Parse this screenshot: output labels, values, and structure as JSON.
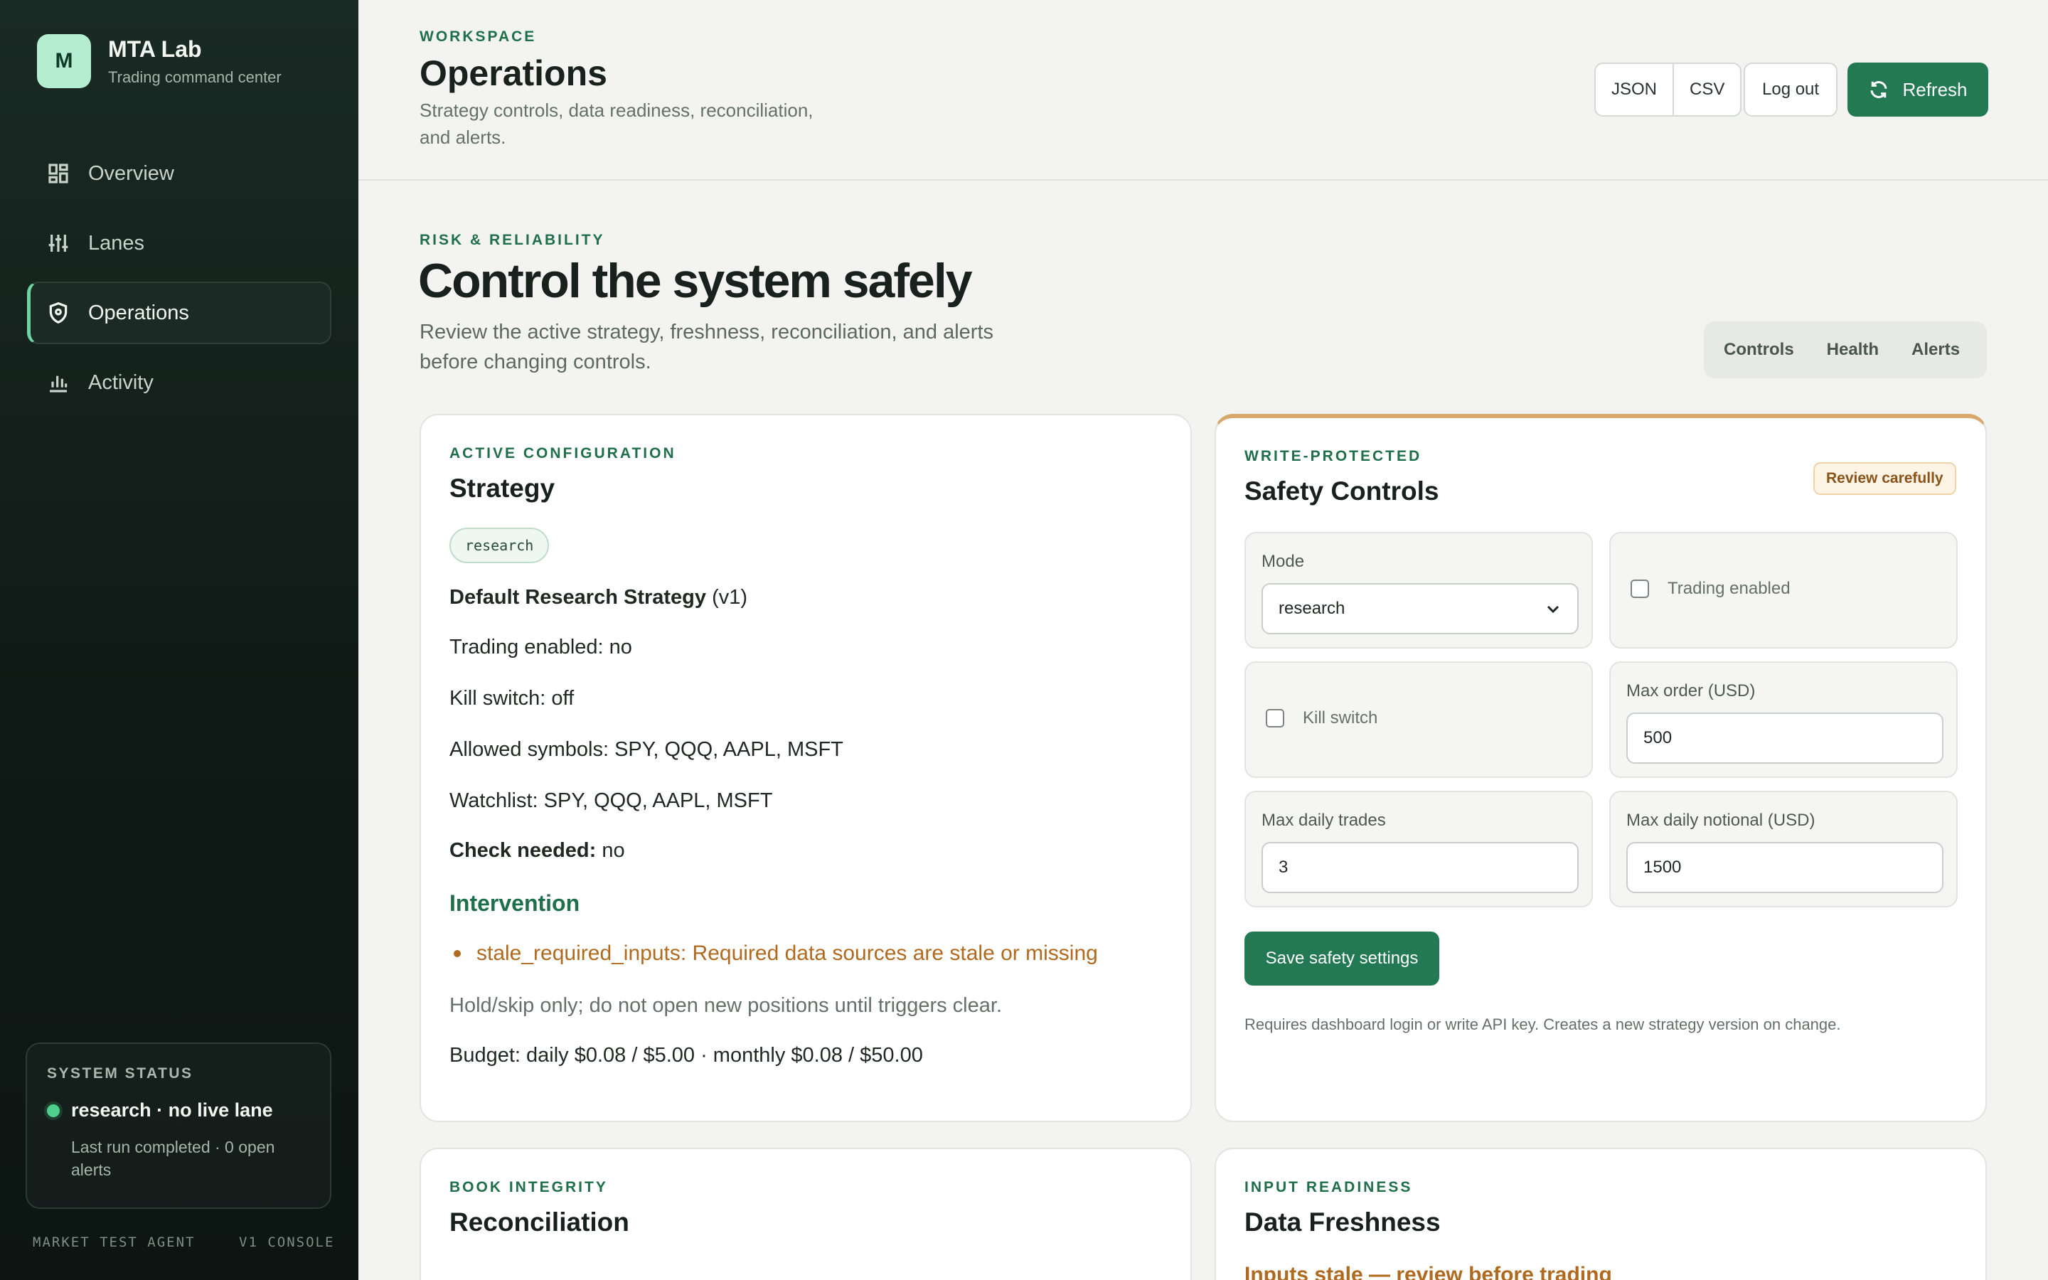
{
  "brand": {
    "logo_letter": "M",
    "name": "MTA Lab",
    "subtitle": "Trading command center"
  },
  "nav": {
    "items": [
      {
        "label": "Overview",
        "icon": "grid-icon"
      },
      {
        "label": "Lanes",
        "icon": "sliders-icon"
      },
      {
        "label": "Operations",
        "icon": "shield-icon",
        "active": true
      },
      {
        "label": "Activity",
        "icon": "bar-chart-icon"
      }
    ]
  },
  "system_status": {
    "title": "SYSTEM STATUS",
    "main": "research · no live lane",
    "sub": "Last run completed · 0 open alerts",
    "indicator_color": "#4fd08c"
  },
  "footer": {
    "left": "MARKET TEST AGENT",
    "right": "V1 CONSOLE"
  },
  "header": {
    "eyebrow": "WORKSPACE",
    "title": "Operations",
    "description": "Strategy controls, data readiness, reconciliation, and alerts.",
    "export_json": "JSON",
    "export_csv": "CSV",
    "logout": "Log out",
    "refresh": "Refresh"
  },
  "main": {
    "eyebrow": "RISK & RELIABILITY",
    "title": "Control the system safely",
    "description": "Review the active strategy, freshness, reconciliation, and alerts before changing controls.",
    "tabs": [
      "Controls",
      "Health",
      "Alerts"
    ]
  },
  "strategy": {
    "eyebrow": "ACTIVE CONFIGURATION",
    "title": "Strategy",
    "tag": "research",
    "name": "Default Research Strategy",
    "version": "(v1)",
    "trading_enabled": "Trading enabled: no",
    "kill_switch": "Kill switch: off",
    "allowed_symbols": "Allowed symbols: SPY, QQQ, AAPL, MSFT",
    "watchlist": "Watchlist: SPY, QQQ, AAPL, MSFT",
    "check_needed_label": "Check needed:",
    "check_needed_value": "no",
    "intervention_title": "Intervention",
    "intervention_item": "stale_required_inputs: Required data sources are stale or missing",
    "hold_note": "Hold/skip only; do not open new positions until triggers clear.",
    "budget": "Budget: daily $0.08 / $5.00 · monthly $0.08 / $50.00"
  },
  "safety": {
    "eyebrow": "WRITE-PROTECTED",
    "title": "Safety Controls",
    "badge": "Review carefully",
    "mode_label": "Mode",
    "mode_value": "research",
    "trading_enabled_label": "Trading enabled",
    "kill_switch_label": "Kill switch",
    "max_order_label": "Max order (USD)",
    "max_order_value": "500",
    "max_daily_trades_label": "Max daily trades",
    "max_daily_trades_value": "3",
    "max_daily_notional_label": "Max daily notional (USD)",
    "max_daily_notional_value": "1500",
    "save": "Save safety settings",
    "note": "Requires dashboard login or write API key. Creates a new strategy version on change."
  },
  "reconciliation": {
    "eyebrow": "BOOK INTEGRITY",
    "title": "Reconciliation"
  },
  "freshness": {
    "eyebrow": "INPUT READINESS",
    "title": "Data Freshness",
    "warning": "Inputs stale — review before trading"
  },
  "colors": {
    "accent": "#237a52",
    "warning": "#b06a1f",
    "sidebar_bg": "#0f1a16"
  }
}
